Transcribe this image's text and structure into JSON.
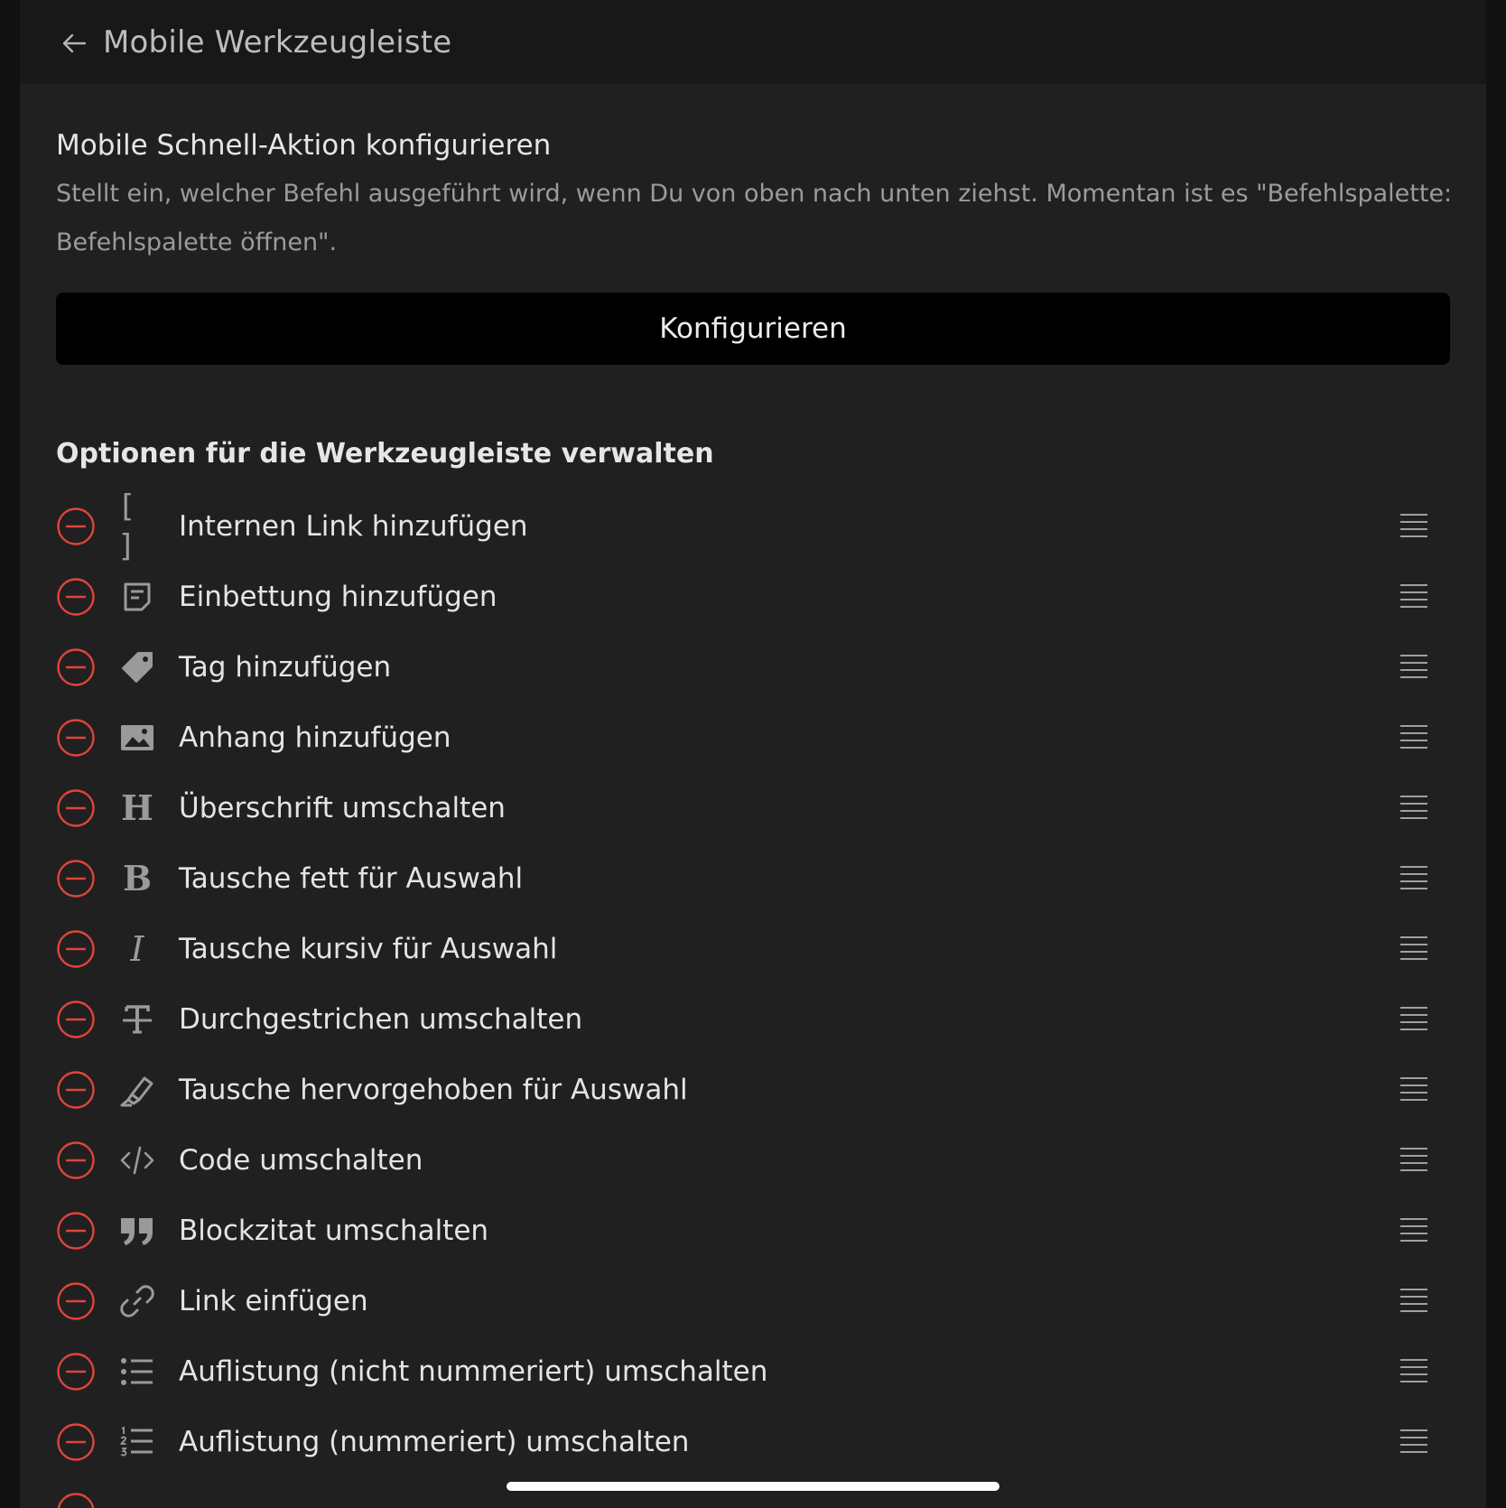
{
  "header": {
    "title": "Mobile Werkzeugleiste",
    "back_icon": "arrow-left-icon"
  },
  "quick_action": {
    "title": "Mobile Schnell-Aktion konfigurieren",
    "description": "Stellt ein, welcher Befehl ausgeführt wird, wenn Du von oben nach unten ziehst. Momentan ist es \"Befehlspalette: Befehlspalette öffnen\".",
    "button_label": "Konfigurieren"
  },
  "toolbar_section": {
    "heading": "Optionen für die Werkzeugleiste verwalten",
    "items": [
      {
        "label": "Internen Link hinzufügen",
        "icon": "brackets-icon"
      },
      {
        "label": "Einbettung hinzufügen",
        "icon": "embed-icon"
      },
      {
        "label": "Tag hinzufügen",
        "icon": "tag-icon"
      },
      {
        "label": "Anhang hinzufügen",
        "icon": "image-icon"
      },
      {
        "label": "Überschrift umschalten",
        "icon": "heading-icon"
      },
      {
        "label": "Tausche fett für Auswahl",
        "icon": "bold-icon"
      },
      {
        "label": "Tausche kursiv für Auswahl",
        "icon": "italic-icon"
      },
      {
        "label": "Durchgestrichen umschalten",
        "icon": "strikethrough-icon"
      },
      {
        "label": "Tausche hervorgehoben für Auswahl",
        "icon": "highlighter-icon"
      },
      {
        "label": "Code umschalten",
        "icon": "code-icon"
      },
      {
        "label": "Blockzitat umschalten",
        "icon": "quote-icon"
      },
      {
        "label": "Link einfügen",
        "icon": "link-icon"
      },
      {
        "label": "Auflistung (nicht nummeriert) umschalten",
        "icon": "bullet-list-icon"
      },
      {
        "label": "Auflistung (nummeriert) umschalten",
        "icon": "numbered-list-icon"
      }
    ]
  },
  "colors": {
    "remove": "#e0443a",
    "background": "#202020",
    "header": "#181818",
    "button": "#000000"
  }
}
